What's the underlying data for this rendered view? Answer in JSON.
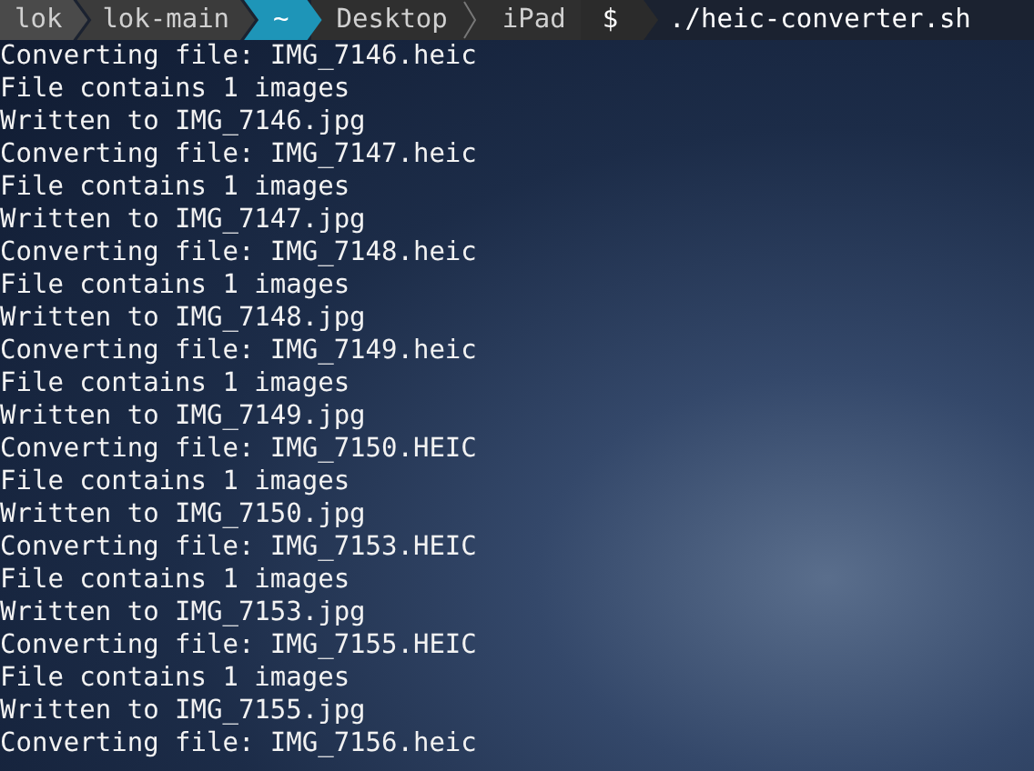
{
  "prompt": {
    "segments": [
      {
        "kind": "user",
        "text": "lok"
      },
      {
        "kind": "host",
        "text": "lok-main"
      },
      {
        "kind": "home",
        "text": "~"
      },
      {
        "kind": "path",
        "text": "Desktop"
      },
      {
        "kind": "path",
        "text": "iPad"
      }
    ],
    "symbol": "$",
    "command": "./heic-converter.sh"
  },
  "output": [
    "Converting file: IMG_7146.heic",
    "File contains 1 images",
    "Written to IMG_7146.jpg",
    "Converting file: IMG_7147.heic",
    "File contains 1 images",
    "Written to IMG_7147.jpg",
    "Converting file: IMG_7148.heic",
    "File contains 1 images",
    "Written to IMG_7148.jpg",
    "Converting file: IMG_7149.heic",
    "File contains 1 images",
    "Written to IMG_7149.jpg",
    "Converting file: IMG_7150.HEIC",
    "File contains 1 images",
    "Written to IMG_7150.jpg",
    "Converting file: IMG_7153.HEIC",
    "File contains 1 images",
    "Written to IMG_7153.jpg",
    "Converting file: IMG_7155.HEIC",
    "File contains 1 images",
    "Written to IMG_7155.jpg",
    "Converting file: IMG_7156.heic"
  ]
}
